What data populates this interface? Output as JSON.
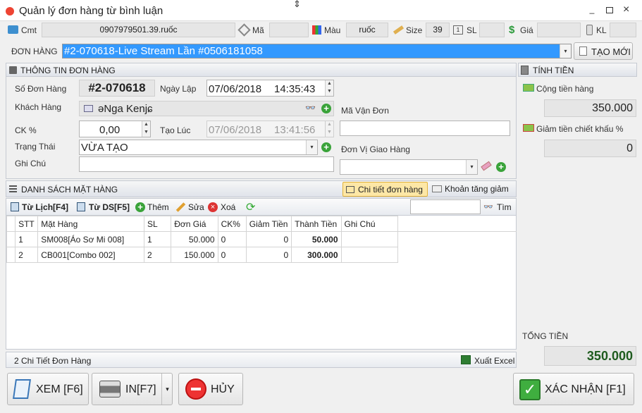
{
  "window": {
    "title": "Quản lý đơn hàng từ bình luận"
  },
  "toprow": {
    "cmt_label": "Cmt",
    "cmt_value": "0907979501.39.ruốc",
    "ma_label": "Mã",
    "mau_label": "Màu",
    "mau_value": "ruốc",
    "size_label": "Size",
    "size_value": "39",
    "sl_label": "SL",
    "gia_label": "Giá",
    "kl_label": "KL"
  },
  "order": {
    "label": "ĐƠN HÀNG",
    "value": "#2-070618-Live Stream Lần #0506181058",
    "new_button": "TẠO MỚI"
  },
  "info": {
    "section_title": "THÔNG TIN ĐƠN HÀNG",
    "so_don_hang_label": "Số Đơn Hàng",
    "so_don_hang": "#2-070618",
    "ngay_lap_label": "Ngày Lập",
    "ngay_lap_date": "07/06/2018",
    "ngay_lap_time": "14:35:43",
    "khach_hang_label": "Khách Hàng",
    "khach_hang": "əNga Kenjɕ",
    "ck_label": "CK %",
    "ck_value": "0,00",
    "tao_luc_label": "Tạo Lúc",
    "tao_luc_date": "07/06/2018",
    "tao_luc_time": "13:41:56",
    "trang_thai_label": "Trạng Thái",
    "trang_thai": "VỪA TẠO",
    "ghi_chu_label": "Ghi Chú",
    "ma_van_don_label": "Mã Vận Đơn",
    "don_vi_label": "Đơn Vị Giao Hàng"
  },
  "tinh_tien": {
    "section_title": "TÍNH TIỀN",
    "cong_label": "Cộng tiền hàng",
    "cong_value": "350.000",
    "giam_label": "Giảm tiền chiết khấu %",
    "giam_value": "0",
    "tong_label": "TỔNG TIỀN",
    "tong_value": "350.000"
  },
  "items": {
    "section_title": "DANH SÁCH MẶT HÀNG",
    "tab_detail": "Chi tiết đơn hàng",
    "tab_discount": "Khoản tăng giảm",
    "tb_tu_lich": "Từ Lịch[F4]",
    "tb_tu_ds": "Từ DS[F5]",
    "tb_them": "Thêm",
    "tb_sua": "Sửa",
    "tb_xoa": "Xoá",
    "tb_tim": "Tìm",
    "columns": [
      "STT",
      "Mặt Hàng",
      "SL",
      "Đơn Giá",
      "CK%",
      "Giảm Tiền",
      "Thành Tiền",
      "Ghi Chú"
    ],
    "rows": [
      [
        "1",
        "SM008[Áo Sơ Mi 008]",
        "1",
        "50.000",
        "0",
        "0",
        "50.000",
        ""
      ],
      [
        "2",
        "CB001[Combo 002]",
        "2",
        "150.000",
        "0",
        "0",
        "300.000",
        ""
      ]
    ],
    "footer_count": "2 Chi Tiết Đơn Hàng",
    "export": "Xuất Excel"
  },
  "buttons": {
    "xem": "XEM [F6]",
    "in": "IN[F7]",
    "huy": "HỦY",
    "xac_nhan": "XÁC NHẬN [F1]"
  },
  "colors": {
    "title_bar": "#ffffff",
    "selection": "#3399ff",
    "total_green": "#1e5b1e"
  }
}
